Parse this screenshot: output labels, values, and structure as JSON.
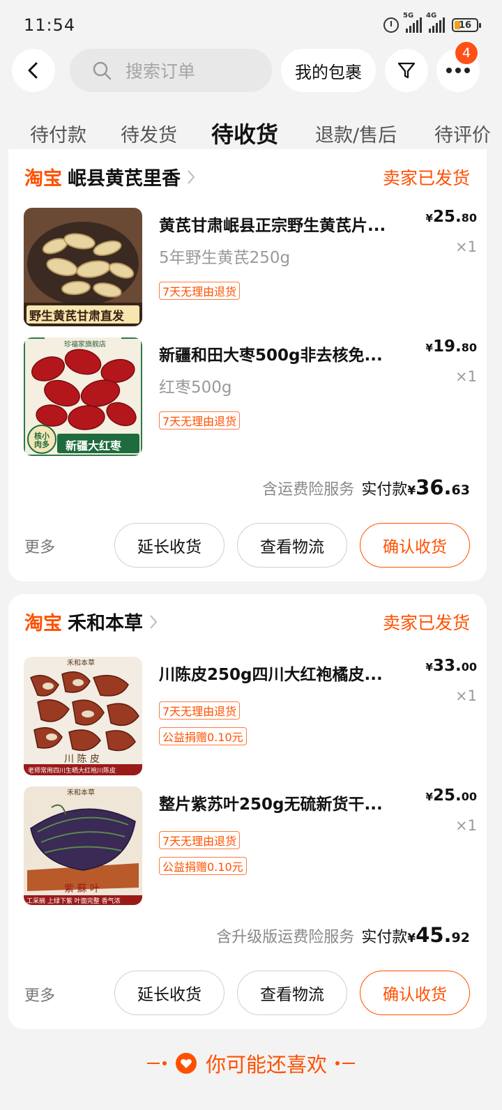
{
  "status_bar": {
    "time": "11:54",
    "net1": "5G",
    "net2": "4G",
    "battery": "16"
  },
  "header": {
    "search_placeholder": "搜索订单",
    "packages_label": "我的包裹",
    "more_badge": "4"
  },
  "tabs": [
    {
      "label": "待付款"
    },
    {
      "label": "待发货"
    },
    {
      "label": "待收货"
    },
    {
      "label": "退款/售后"
    },
    {
      "label": "待评价"
    }
  ],
  "orders": [
    {
      "platform": "淘宝",
      "shop": "岷县黄芪里香",
      "status": "卖家已发货",
      "items": [
        {
          "title": "黄芪甘肃岷县正宗野生黄芪片...",
          "sku": "5年野生黄芪250g",
          "price_yen": "¥",
          "price_int": "25.",
          "price_dec": "80",
          "qty": "×1",
          "tags": [
            "7天无理由退货"
          ],
          "thumb_caption": "野生黄芪甘肃直发"
        },
        {
          "title": "新疆和田大枣500g非去核免...",
          "sku": "红枣500g",
          "price_yen": "¥",
          "price_int": "19.",
          "price_dec": "80",
          "qty": "×1",
          "tags": [
            "7天无理由退货"
          ],
          "thumb_caption": "新疆大红枣",
          "thumb_badge": "核小肉多",
          "thumb_top": "珍福家旗舰店"
        }
      ],
      "insurance": "含运费险服务",
      "paid_label": "实付款",
      "paid_yen": "¥",
      "paid_int": "36.",
      "paid_dec": "63",
      "more": "更多",
      "btn_extend": "延长收货",
      "btn_logistics": "查看物流",
      "btn_confirm": "确认收货"
    },
    {
      "platform": "淘宝",
      "shop": "禾和本草",
      "status": "卖家已发货",
      "items": [
        {
          "title": "川陈皮250g四川大红袍橘皮...",
          "sku": "",
          "price_yen": "¥",
          "price_int": "33.",
          "price_dec": "00",
          "qty": "×1",
          "tags": [
            "7天无理由退货",
            "公益捐赠0.10元"
          ],
          "thumb_caption": "川 陈 皮",
          "thumb_top": "禾和本草",
          "thumb_strip": "老师常用四川生晒大红袍川陈皮"
        },
        {
          "title": "整片紫苏叶250g无硫新货干...",
          "sku": "",
          "price_yen": "¥",
          "price_int": "25.",
          "price_dec": "00",
          "qty": "×1",
          "tags": [
            "7天无理由退货",
            "公益捐赠0.10元"
          ],
          "thumb_caption": "紫 蘇 叶",
          "thumb_top": "禾和本草",
          "thumb_strip": "工采摘 上绿下紫 叶面完整 香气浓"
        }
      ],
      "insurance": "含升级版运费险服务",
      "paid_label": "实付款",
      "paid_yen": "¥",
      "paid_int": "45.",
      "paid_dec": "92",
      "more": "更多",
      "btn_extend": "延长收货",
      "btn_logistics": "查看物流",
      "btn_confirm": "确认收货"
    }
  ],
  "recommend": {
    "label": "你可能还喜欢"
  },
  "colors": {
    "accent": "#ff5000",
    "background": "#f3f3f3"
  }
}
